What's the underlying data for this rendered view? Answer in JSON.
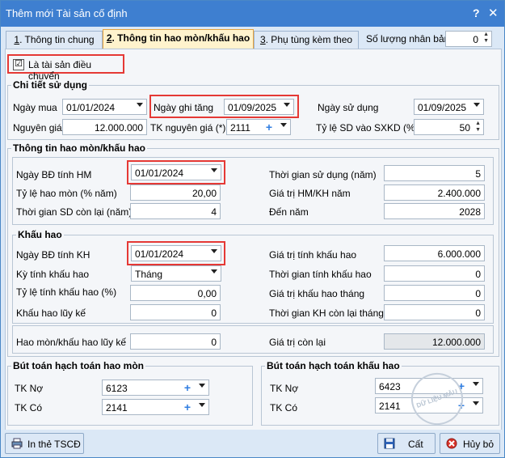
{
  "window": {
    "title": "Thêm mới Tài sản cố định",
    "help": "?",
    "close": "✕"
  },
  "tabs": [
    {
      "num": "1",
      "label": ". Thông tin chung"
    },
    {
      "num": "2",
      "label": ". Thông tin hao mòn/khấu hao"
    },
    {
      "num": "3",
      "label": ". Phụ tùng kèm theo"
    }
  ],
  "so_luong_nhan_ban": {
    "label": "Số lượng nhân bản",
    "value": "0"
  },
  "checkbox": {
    "label": "Là tài sản điều chuyển",
    "checked": "☑"
  },
  "chi_tiet": {
    "title": "Chi tiết sử dụng",
    "ngay_mua": {
      "label": "Ngày mua",
      "value": "01/01/2024"
    },
    "ngay_ghi_tang": {
      "label": "Ngày ghi tăng",
      "value": "01/09/2025"
    },
    "ngay_su_dung": {
      "label": "Ngày sử dụng",
      "value": "01/09/2025"
    },
    "nguyen_gia": {
      "label": "Nguyên giá",
      "value": "12.000.000"
    },
    "tk_nguyen_gia": {
      "label": "TK nguyên giá (*)",
      "value": "2111"
    },
    "ty_le_sd": {
      "label": "Tỷ lệ SD vào SXKD (%)",
      "value": "50"
    }
  },
  "hao_mon": {
    "title": "Thông tin hao mòn/khấu hao",
    "ngay_bd_hm": {
      "label": "Ngày BĐ tính HM",
      "value": "01/01/2024"
    },
    "ty_le_hm": {
      "label": "Tỷ lệ hao mòn (% năm)",
      "value": "20,00"
    },
    "tg_sd_con_lai": {
      "label": "Thời gian SD còn lại (năm)",
      "value": "4"
    },
    "tg_su_dung": {
      "label": "Thời gian sử dụng (năm)",
      "value": "5"
    },
    "gia_tri_hm_kh": {
      "label": "Giá trị HM/KH năm",
      "value": "2.400.000"
    },
    "den_nam": {
      "label": "Đến năm",
      "value": "2028"
    }
  },
  "khau_hao": {
    "title": "Khấu hao",
    "ngay_bd_kh": {
      "label": "Ngày BĐ tính KH",
      "value": "01/01/2024"
    },
    "ky_tinh": {
      "label": "Kỳ tính khấu hao",
      "value": "Tháng"
    },
    "ty_le_kh": {
      "label": "Tỷ lệ tính khấu hao (%)",
      "value": "0,00"
    },
    "kh_luy_ke": {
      "label": "Khấu hao lũy kế",
      "value": "0"
    },
    "gia_tri_tinh_kh": {
      "label": "Giá trị tính khấu hao",
      "value": "6.000.000"
    },
    "tg_tinh_kh": {
      "label": "Thời gian tính khấu hao",
      "value": "0"
    },
    "gia_tri_kh_thang": {
      "label": "Giá trị khấu hao tháng",
      "value": "0"
    },
    "tg_kh_con_lai": {
      "label": "Thời gian KH còn lại tháng",
      "value": "0"
    }
  },
  "summary": {
    "hm_kh_luy_ke": {
      "label": "Hao mòn/khấu hao lũy kế",
      "value": "0"
    },
    "gia_tri_con_lai": {
      "label": "Giá trị còn lại",
      "value": "12.000.000"
    }
  },
  "but_toan_hm": {
    "title": "Bút toán hạch toán hao mòn",
    "tk_no": {
      "label": "TK Nợ",
      "value": "6123"
    },
    "tk_co": {
      "label": "TK Có",
      "value": "2141"
    }
  },
  "but_toan_kh": {
    "title": "Bút toán hạch toán khấu hao",
    "tk_no": {
      "label": "TK Nợ",
      "value": "6423"
    },
    "tk_co": {
      "label": "TK Có",
      "value": "2141"
    }
  },
  "buttons": {
    "print": "In thẻ TSCĐ",
    "save": "Cất",
    "cancel": "Hủy bỏ"
  },
  "watermark": "DỮ LIỆU MẪU",
  "colors": {
    "titlebar": "#3e7fd0",
    "highlight": "#e53935",
    "active_tab": "#fff3cd",
    "plus": "#2f7de1"
  }
}
